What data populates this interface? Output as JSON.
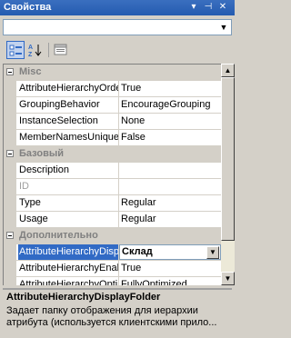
{
  "window": {
    "title": "Свойства"
  },
  "title_buttons": [
    "▾",
    "⊣",
    "✕"
  ],
  "object_selector": {
    "value": ""
  },
  "toolbar": {
    "buttons": [
      {
        "name": "categorized-view",
        "icon": "categorized-icon",
        "active": true
      },
      {
        "name": "alphabetical-view",
        "icon": "sort-az-icon",
        "active": false
      },
      {
        "name": "property-pages",
        "icon": "property-pages-icon",
        "active": false
      }
    ]
  },
  "grid": {
    "rows": [
      {
        "type": "cat",
        "name": "Misc"
      },
      {
        "type": "prop",
        "name": "AttributeHierarchyOrdered",
        "value": "True"
      },
      {
        "type": "prop",
        "name": "GroupingBehavior",
        "value": "EncourageGrouping"
      },
      {
        "type": "prop",
        "name": "InstanceSelection",
        "value": "None"
      },
      {
        "type": "prop",
        "name": "MemberNamesUnique",
        "value": "False"
      },
      {
        "type": "cat",
        "name": "Базовый"
      },
      {
        "type": "prop",
        "name": "Description",
        "value": ""
      },
      {
        "type": "prop",
        "name": "ID",
        "value": "",
        "disabled": true
      },
      {
        "type": "prop",
        "name": "Type",
        "value": "Regular"
      },
      {
        "type": "prop",
        "name": "Usage",
        "value": "Regular"
      },
      {
        "type": "cat",
        "name": "Дополнительно"
      },
      {
        "type": "prop",
        "name": "AttributeHierarchyDisplayFolder",
        "value": "Склад",
        "selected": true
      },
      {
        "type": "prop",
        "name": "AttributeHierarchyEnabled",
        "value": "True"
      },
      {
        "type": "prop",
        "name": "AttributeHierarchyOptimizedState",
        "value": "FullyOptimized"
      }
    ]
  },
  "description": {
    "title": "AttributeHierarchyDisplayFolder",
    "text": "Задает папку отображения для иерархии атрибута (используется клиентскими прило..."
  }
}
